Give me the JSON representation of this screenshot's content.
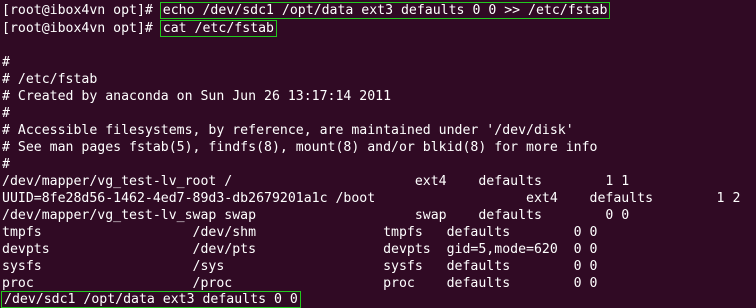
{
  "terminal": {
    "prompt_1": "[root@ibox4vn opt]# ",
    "command_1": "echo /dev/sdc1 /opt/data ext3 defaults 0 0 >> /etc/fstab",
    "prompt_2": "[root@ibox4vn opt]# ",
    "command_2": "cat /etc/fstab",
    "output": [
      "",
      "#",
      "# /etc/fstab",
      "# Created by anaconda on Sun Jun 26 13:17:14 2011",
      "#",
      "# Accessible filesystems, by reference, are maintained under '/dev/disk'",
      "# See man pages fstab(5), findfs(8), mount(8) and/or blkid(8) for more info",
      "#",
      "/dev/mapper/vg_test-lv_root /                       ext4    defaults        1 1",
      "UUID=8fe28d56-1462-4ed7-89d3-db2679201a1c /boot                   ext4    defaults        1 2",
      "/dev/mapper/vg_test-lv_swap swap                    swap    defaults        0 0",
      "tmpfs                   /dev/shm                tmpfs   defaults        0 0",
      "devpts                  /dev/pts                devpts  gid=5,mode=620  0 0",
      "sysfs                   /sys                    sysfs   defaults        0 0",
      "proc                    /proc                   proc    defaults        0 0"
    ],
    "last_line": "/dev/sdc1 /opt/data ext3 defaults 0 0",
    "colors": {
      "background": "#300a24",
      "text": "#ffffff",
      "highlight_box": "#22c81e"
    }
  }
}
